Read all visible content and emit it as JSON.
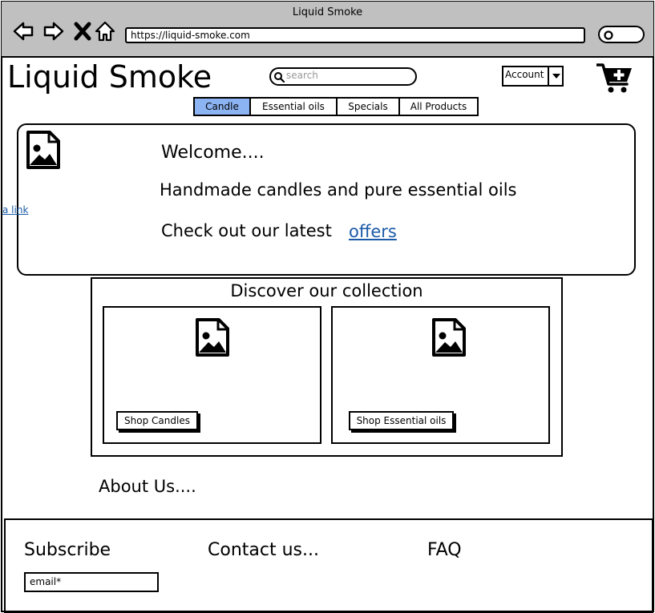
{
  "browser": {
    "window_title": "Liquid Smoke",
    "url": "https://liquid-smoke.com"
  },
  "header": {
    "logo": "Liquid Smoke",
    "search_placeholder": "search",
    "account_label": "Account"
  },
  "tabs": [
    {
      "label": "Candle",
      "active": true
    },
    {
      "label": "Essential oils",
      "active": false
    },
    {
      "label": "Specials",
      "active": false
    },
    {
      "label": "All Products",
      "active": false
    }
  ],
  "hero": {
    "welcome": "Welcome....",
    "tagline": "Handmade candles and pure essential oils",
    "offers_prefix": "Check out our latest",
    "offers_link": "offers"
  },
  "side_link": "a link",
  "collection": {
    "title": "Discover our collection",
    "cards": [
      {
        "button": "Shop Candles"
      },
      {
        "button": "Shop Essential oils"
      }
    ]
  },
  "about": "About Us....",
  "footer": {
    "subscribe": "Subscribe",
    "email_placeholder": "email*",
    "contact": "Contact us...",
    "faq": "FAQ"
  }
}
